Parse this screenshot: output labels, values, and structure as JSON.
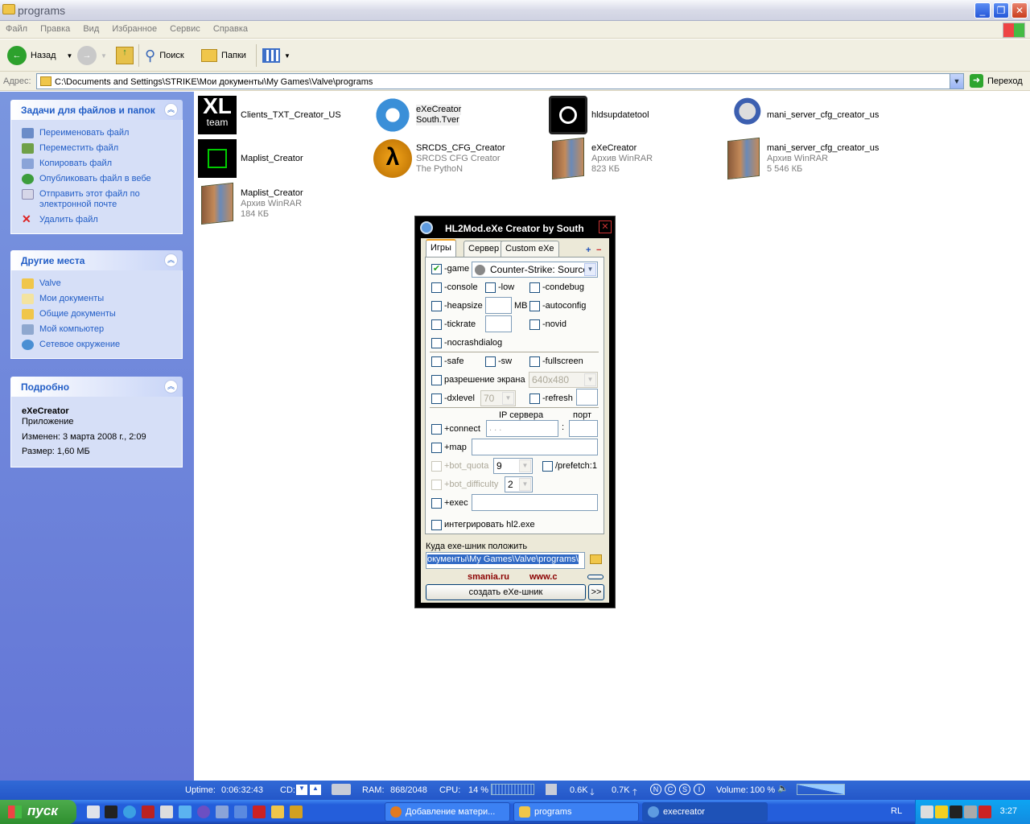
{
  "window": {
    "title": "programs"
  },
  "menu": [
    "Файл",
    "Правка",
    "Вид",
    "Избранное",
    "Сервис",
    "Справка"
  ],
  "toolbar": {
    "back": "Назад",
    "search": "Поиск",
    "folders": "Папки"
  },
  "address": {
    "label": "Адрес:",
    "value": "C:\\Documents and Settings\\STRIKE\\Мои документы\\My Games\\Valve\\programs",
    "go": "Переход"
  },
  "sidebar": {
    "tasks": {
      "title": "Задачи для файлов и папок",
      "items": [
        "Переименовать файл",
        "Переместить файл",
        "Копировать файл",
        "Опубликовать файл в вебе",
        "Отправить этот файл по электронной почте",
        "Удалить файл"
      ]
    },
    "places": {
      "title": "Другие места",
      "items": [
        "Valve",
        "Мои документы",
        "Общие документы",
        "Мой компьютер",
        "Сетевое окружение"
      ]
    },
    "details": {
      "title": "Подробно",
      "name": "eXeCreator",
      "type": "Приложение",
      "modified": "Изменен: 3 марта 2008 г., 2:09",
      "size": "Размер: 1,60 МБ"
    }
  },
  "files": [
    {
      "name": "Clients_TXT_Creator_US",
      "sub1": "",
      "sub2": "",
      "icon": "xl-team-icon"
    },
    {
      "name": "eXeCreator",
      "name2": "South.Tver",
      "sub1": "",
      "sub2": "",
      "icon": "gear-icon"
    },
    {
      "name": "hldsupdatetool",
      "sub1": "",
      "sub2": "",
      "icon": "steam-icon"
    },
    {
      "name": "mani_server_cfg_creator_us",
      "sub1": "",
      "sub2": "",
      "icon": "gear-ring-icon"
    },
    {
      "name": "Maplist_Creator",
      "sub1": "",
      "sub2": "",
      "icon": "square-target-icon"
    },
    {
      "name": "SRCDS_CFG_Creator",
      "sub1": "SRCDS CFG Creator",
      "sub2": "The PythoN",
      "icon": "half-life-icon"
    },
    {
      "name": "eXeCreator",
      "sub1": "Архив WinRAR",
      "sub2": "823 КБ",
      "icon": "winrar-icon"
    },
    {
      "name": "mani_server_cfg_creator_us",
      "sub1": "Архив WinRAR",
      "sub2": "5 546 КБ",
      "icon": "winrar-icon"
    },
    {
      "name": "Maplist_Creator",
      "sub1": "Архив WinRAR",
      "sub2": "184 КБ",
      "icon": "winrar-icon"
    }
  ],
  "dialog": {
    "title": "HL2Mod.eXe Creator by South",
    "tabs": [
      "Игры",
      "Сервер",
      "Custom eXe"
    ],
    "plus": "+",
    "minus": "−",
    "game_label": "-game",
    "game_value": "Counter-Strike: Source",
    "console": "-console",
    "low": "-low",
    "condebug": "-condebug",
    "heapsize": "-heapsize",
    "mb": "MB",
    "autoconfig": "-autoconfig",
    "tickrate": "-tickrate",
    "novid": "-novid",
    "nocrashdialog": "-nocrashdialog",
    "safe": "-safe",
    "sw": "-sw",
    "fullscreen": "-fullscreen",
    "resolution": "разрешение экрана",
    "resolution_value": "640x480",
    "dxlevel": "-dxlevel",
    "dxlevel_value": "70",
    "refresh": "-refresh",
    "ip_header": "IP сервера",
    "port_header": "порт",
    "connect": "+connect",
    "ip_value": ".    .    .",
    "colon": ":",
    "map": "+map",
    "bot_quota": "+bot_quota",
    "bot_quota_value": "9",
    "prefetch": "/prefetch:1",
    "bot_difficulty": "+bot_difficulty",
    "bot_difficulty_value": "2",
    "exec": "+exec",
    "integrate": "интегрировать hl2.exe",
    "path_label": "Куда exe-шник положить",
    "path_value": "окументы\\My Games\\Valve\\programs\\",
    "link1": "smania.ru",
    "link2": "www.c",
    "create": "создать eXe-шник",
    "more": ">>",
    "checked": {
      "game": true
    }
  },
  "statusbar": {
    "uptime": "Uptime:",
    "uptime_value": "0:06:32:43",
    "cd": "CD:",
    "ram": "RAM:",
    "ram_value": "868/2048",
    "cpu": "CPU:",
    "cpu_value": "14 %",
    "down": "0.6K",
    "up": "0.7K",
    "volume": "Volume:",
    "volume_value": "100 %"
  },
  "taskbar": {
    "start": "пуск",
    "tasks": [
      "Добавление матери...",
      "programs",
      "execreator"
    ],
    "lang": "RL",
    "clock": "3:27"
  }
}
